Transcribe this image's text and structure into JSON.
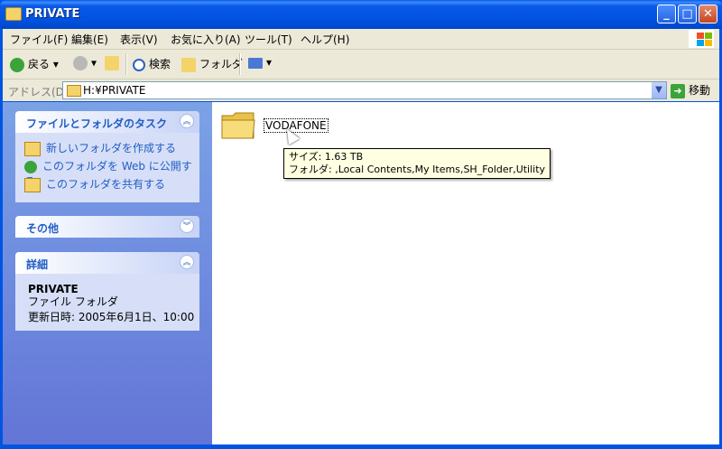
{
  "window": {
    "title": "PRIVATE"
  },
  "titlebar_buttons": {
    "minimize": "_",
    "maximize": "□",
    "close": "✕"
  },
  "menu": [
    "ファイル(F)",
    "編集(E)",
    "表示(V)",
    "お気に入り(A)",
    "ツール(T)",
    "ヘルプ(H)"
  ],
  "toolbar": {
    "back": "戻る",
    "search": "検索",
    "folders": "フォルダ"
  },
  "address": {
    "label": "アドレス(D)",
    "value": "H:¥PRIVATE",
    "go": "移動"
  },
  "tasks_panel": {
    "title": "ファイルとフォルダのタスク",
    "items": [
      "新しいフォルダを作成する",
      "このフォルダを Web に公開する",
      "このフォルダを共有する"
    ]
  },
  "other_panel": {
    "title": "その他"
  },
  "details_panel": {
    "title": "詳細",
    "name": "PRIVATE",
    "type": "ファイル フォルダ",
    "modified": "更新日時: 2005年6月1日、10:00"
  },
  "items": [
    {
      "name": "VODAFONE",
      "tooltip_size": "サイズ: 1.63 TB",
      "tooltip_folders": "フォルダ: ,Local Contents,My Items,SH_Folder,Utility"
    }
  ],
  "colors": {
    "titlebar": "#0054e3",
    "task_link": "#215dc6",
    "panel_bg": "#d6dff7",
    "tooltip_bg": "#ffffe1"
  }
}
